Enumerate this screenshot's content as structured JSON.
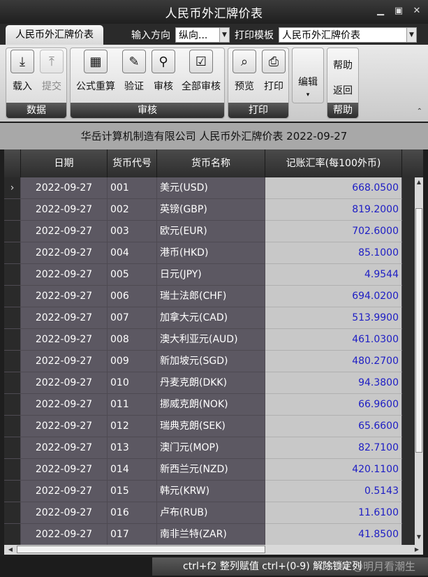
{
  "window": {
    "title": "人民币外汇牌价表"
  },
  "toolbar_row": {
    "tab_label": "人民币外汇牌价表",
    "input_direction_label": "输入方向",
    "input_direction_value": "纵向...",
    "print_template_label": "打印模板",
    "print_template_value": "人民币外汇牌价表"
  },
  "ribbon": {
    "groups": {
      "data": "数据",
      "audit": "审核",
      "print": "打印",
      "help": "帮助"
    },
    "buttons": {
      "load": "载入",
      "submit": "提交",
      "formula_recalc": "公式重算",
      "verify": "验证",
      "audit": "审核",
      "audit_all": "全部审核",
      "preview": "预览",
      "print": "打印",
      "edit": "编辑",
      "help": "帮助",
      "back": "返回"
    }
  },
  "caption": "华岳计算机制造有限公司 人民币外汇牌价表 2022-09-27",
  "grid": {
    "columns": [
      "日期",
      "货币代号",
      "货币名称",
      "记账汇率(每100外币)"
    ],
    "current_row_marker": "›",
    "rows": [
      {
        "date": "2022-09-27",
        "code": "001",
        "name": "美元(USD)",
        "rate": "668.0500"
      },
      {
        "date": "2022-09-27",
        "code": "002",
        "name": "英镑(GBP)",
        "rate": "819.2000"
      },
      {
        "date": "2022-09-27",
        "code": "003",
        "name": "欧元(EUR)",
        "rate": "702.6000"
      },
      {
        "date": "2022-09-27",
        "code": "004",
        "name": "港币(HKD)",
        "rate": "85.1000"
      },
      {
        "date": "2022-09-27",
        "code": "005",
        "name": "日元(JPY)",
        "rate": "4.9544"
      },
      {
        "date": "2022-09-27",
        "code": "006",
        "name": "瑞士法郎(CHF)",
        "rate": "694.0200"
      },
      {
        "date": "2022-09-27",
        "code": "007",
        "name": "加拿大元(CAD)",
        "rate": "513.9900"
      },
      {
        "date": "2022-09-27",
        "code": "008",
        "name": "澳大利亚元(AUD)",
        "rate": "461.0300"
      },
      {
        "date": "2022-09-27",
        "code": "009",
        "name": "新加坡元(SGD)",
        "rate": "480.2700"
      },
      {
        "date": "2022-09-27",
        "code": "010",
        "name": "丹麦克朗(DKK)",
        "rate": "94.3800"
      },
      {
        "date": "2022-09-27",
        "code": "011",
        "name": "挪威克朗(NOK)",
        "rate": "66.9600"
      },
      {
        "date": "2022-09-27",
        "code": "012",
        "name": "瑞典克朗(SEK)",
        "rate": "65.6600"
      },
      {
        "date": "2022-09-27",
        "code": "013",
        "name": "澳门元(MOP)",
        "rate": "82.7100"
      },
      {
        "date": "2022-09-27",
        "code": "014",
        "name": "新西兰元(NZD)",
        "rate": "420.1100"
      },
      {
        "date": "2022-09-27",
        "code": "015",
        "name": "韩元(KRW)",
        "rate": "0.5143"
      },
      {
        "date": "2022-09-27",
        "code": "016",
        "name": "卢布(RUB)",
        "rate": "11.6100"
      },
      {
        "date": "2022-09-27",
        "code": "017",
        "name": "南非兰特(ZAR)",
        "rate": "41.8500"
      }
    ]
  },
  "statusbar": {
    "message": "ctrl+f2 整列赋值 ctrl+(0-9) 解除锁定列",
    "watermark": "CSDN @明月看潮生"
  }
}
